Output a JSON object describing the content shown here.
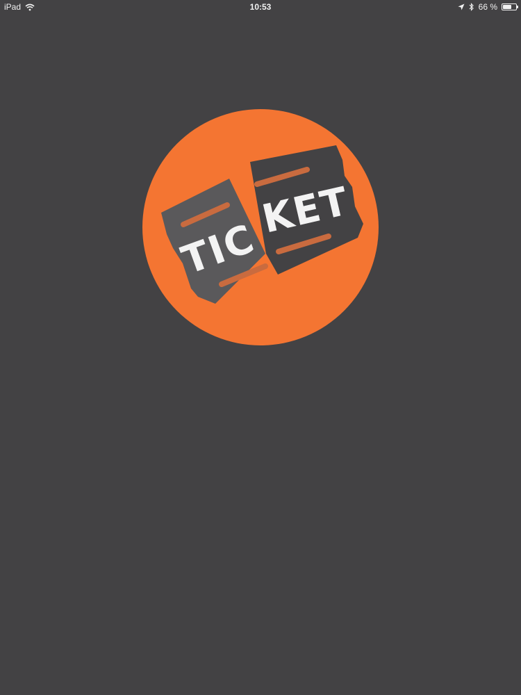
{
  "status_bar": {
    "device": "iPad",
    "time": "10:53",
    "battery_text": "66 %",
    "battery_level": 0.66,
    "icons": [
      "wifi-icon",
      "location-arrow-icon",
      "bluetooth-icon",
      "battery-icon"
    ]
  },
  "splash": {
    "logo_text": "TICKET",
    "logo_part_left": "TIC",
    "logo_part_right": "KET",
    "colors": {
      "background": "#434244",
      "circle": "#f47532",
      "ticket_left": "#5a595b",
      "ticket_right": "#434244",
      "stripe": "#c96b3f",
      "text": "#f3f3f3"
    }
  }
}
